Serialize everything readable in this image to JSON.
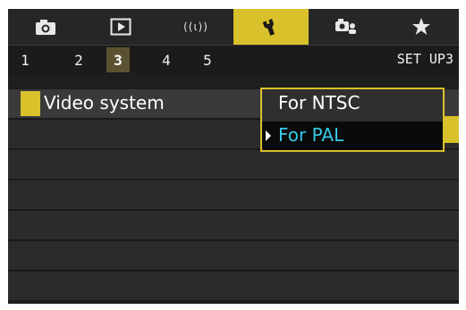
{
  "tabs": [
    {
      "icon": "camera-icon"
    },
    {
      "icon": "playback-icon"
    },
    {
      "icon": "wireless-icon",
      "label": "((ι))"
    },
    {
      "icon": "wrench-icon",
      "active": true
    },
    {
      "icon": "custom-functions-icon"
    },
    {
      "icon": "star-icon"
    }
  ],
  "pages": {
    "numbers": [
      "1",
      "2",
      "3",
      "4",
      "5"
    ],
    "active": "3",
    "title": "SET UP3"
  },
  "menu": {
    "selected_item": "Video system"
  },
  "dropdown": {
    "options": [
      "For NTSC",
      "For PAL"
    ],
    "highlighted": "For PAL"
  },
  "colors": {
    "accent": "#d9c12b",
    "highlight_text": "#36c9e8",
    "background": "#1e1e1e"
  }
}
